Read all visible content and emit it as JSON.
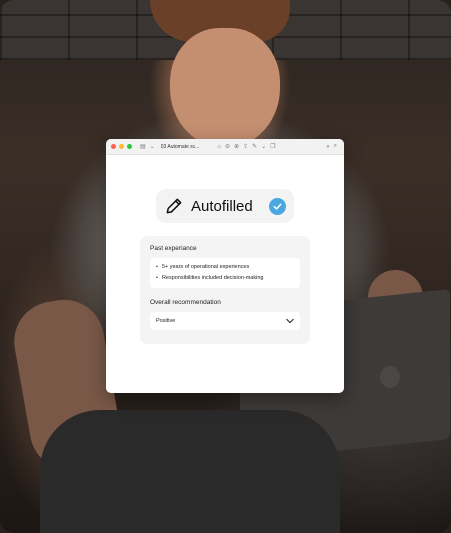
{
  "browser": {
    "tab_title": "03 Automate sc...",
    "icons": [
      "traffic-lights",
      "sidebar-icon",
      "chevron-down-icon",
      "home-icon",
      "zoom-out-icon",
      "zoom-in-icon",
      "share-icon",
      "pen-icon",
      "chevron-down-icon",
      "copy-icon",
      "more-icon",
      "search-icon"
    ]
  },
  "badge": {
    "label": "Autofilled",
    "icon": "pencil-icon",
    "status_icon": "check-circle-icon",
    "accent_color": "#4aa7e0"
  },
  "past_experience": {
    "label": "Past experiance",
    "items": [
      "5+ years of operational experiences",
      "Responsibilities included decision-making"
    ]
  },
  "recommendation": {
    "label": "Overall recommendation",
    "value": "Positive"
  }
}
